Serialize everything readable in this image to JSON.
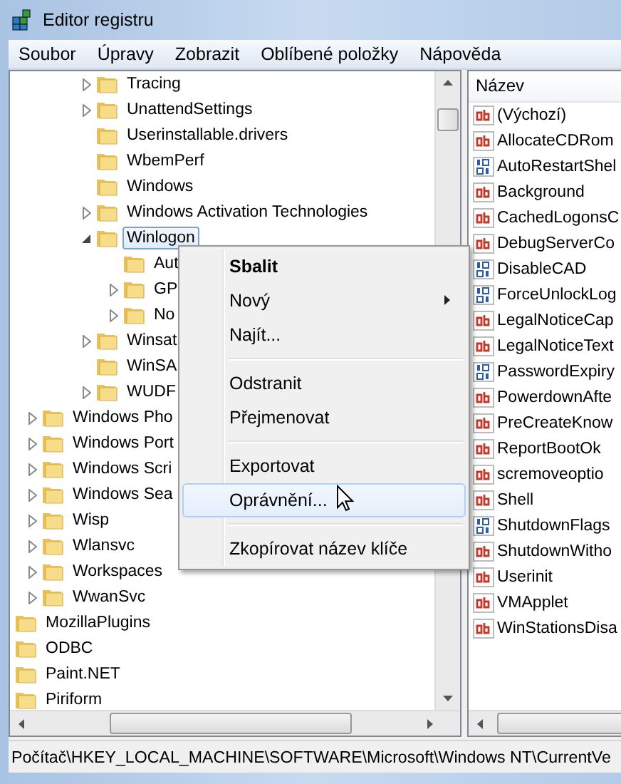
{
  "window": {
    "title": "Editor registru"
  },
  "menu_bar": [
    "Soubor",
    "Úpravy",
    "Zobrazit",
    "Oblíbené položky",
    "Nápověda"
  ],
  "tree": {
    "items": [
      {
        "children": [
          {
            "children": [
              {
                "children": [
                  {
                    "label": "Tracing",
                    "expanded": false,
                    "selected": false
                  },
                  {
                    "label": "UnattendSettings",
                    "expanded": false,
                    "selected": false
                  },
                  {
                    "label": "Userinstallable.drivers",
                    "selected": false
                  },
                  {
                    "label": "WbemPerf",
                    "selected": false
                  },
                  {
                    "label": "Windows",
                    "selected": false
                  },
                  {
                    "label": "Windows Activation Technologies",
                    "expanded": false,
                    "selected": false
                  },
                  {
                    "label": "Winlogon",
                    "expanded": true,
                    "selected": true,
                    "children": [
                      {
                        "label": "Aut",
                        "selected": false
                      },
                      {
                        "label": "GP",
                        "expanded": false,
                        "selected": false
                      },
                      {
                        "label": "No",
                        "expanded": false,
                        "selected": false
                      }
                    ]
                  },
                  {
                    "label": "Winsat",
                    "expanded": false,
                    "selected": false
                  },
                  {
                    "label": "WinSA",
                    "selected": false
                  },
                  {
                    "label": "WUDF",
                    "expanded": false,
                    "selected": false
                  }
                ]
              }
            ]
          },
          {
            "label": "Windows Pho",
            "expanded": false,
            "selected": false
          },
          {
            "label": "Windows Port",
            "expanded": false,
            "selected": false
          },
          {
            "label": "Windows Scri",
            "expanded": false,
            "selected": false
          },
          {
            "label": "Windows Sea",
            "expanded": false,
            "selected": false
          },
          {
            "label": "Wisp",
            "expanded": false,
            "selected": false
          },
          {
            "label": "Wlansvc",
            "expanded": false,
            "selected": false
          },
          {
            "label": "Workspaces",
            "expanded": false,
            "selected": false
          },
          {
            "label": "WwanSvc",
            "expanded": false,
            "selected": false
          }
        ]
      },
      {
        "label": "MozillaPlugins",
        "selected": false
      },
      {
        "label": "ODBC",
        "selected": false
      },
      {
        "label": "Paint.NET",
        "selected": false
      },
      {
        "label": "Piriform",
        "selected": false
      }
    ]
  },
  "context_menu": {
    "items": [
      {
        "kind": "item",
        "label": "Sbalit",
        "bold": true,
        "submenu": false,
        "selected": false
      },
      {
        "kind": "item",
        "label": "Nový",
        "bold": false,
        "submenu": true,
        "selected": false
      },
      {
        "kind": "item",
        "label": "Najít...",
        "bold": false,
        "submenu": false,
        "selected": false
      },
      {
        "kind": "separator"
      },
      {
        "kind": "item",
        "label": "Odstranit",
        "bold": false,
        "submenu": false,
        "selected": false
      },
      {
        "kind": "item",
        "label": "Přejmenovat",
        "bold": false,
        "submenu": false,
        "selected": false
      },
      {
        "kind": "separator"
      },
      {
        "kind": "item",
        "label": "Exportovat",
        "bold": false,
        "submenu": false,
        "selected": false
      },
      {
        "kind": "item",
        "label": "Oprávnění...",
        "bold": false,
        "submenu": false,
        "selected": true
      },
      {
        "kind": "separator"
      },
      {
        "kind": "item",
        "label": "Zkopírovat název klíče",
        "bold": false,
        "submenu": false,
        "selected": false
      }
    ]
  },
  "values": {
    "column": "Název",
    "rows": [
      {
        "kind": "string",
        "name": "(Výchozí)"
      },
      {
        "kind": "string",
        "name": "AllocateCDRom"
      },
      {
        "kind": "binary",
        "name": "AutoRestartShel"
      },
      {
        "kind": "string",
        "name": "Background"
      },
      {
        "kind": "string",
        "name": "CachedLogonsC"
      },
      {
        "kind": "string",
        "name": "DebugServerCo"
      },
      {
        "kind": "binary",
        "name": "DisableCAD"
      },
      {
        "kind": "binary",
        "name": "ForceUnlockLog"
      },
      {
        "kind": "string",
        "name": "LegalNoticeCap"
      },
      {
        "kind": "string",
        "name": "LegalNoticeText"
      },
      {
        "kind": "binary",
        "name": "PasswordExpiry"
      },
      {
        "kind": "string",
        "name": "PowerdownAfte"
      },
      {
        "kind": "string",
        "name": "PreCreateKnow"
      },
      {
        "kind": "string",
        "name": "ReportBootOk"
      },
      {
        "kind": "string",
        "name": "scremoveoptio"
      },
      {
        "kind": "string",
        "name": "Shell"
      },
      {
        "kind": "binary",
        "name": "ShutdownFlags"
      },
      {
        "kind": "string",
        "name": "ShutdownWitho"
      },
      {
        "kind": "string",
        "name": "Userinit"
      },
      {
        "kind": "string",
        "name": "VMApplet"
      },
      {
        "kind": "string",
        "name": "WinStationsDisa"
      }
    ]
  },
  "status_bar": "Počítač\\HKEY_LOCAL_MACHINE\\SOFTWARE\\Microsoft\\Windows NT\\CurrentVe"
}
